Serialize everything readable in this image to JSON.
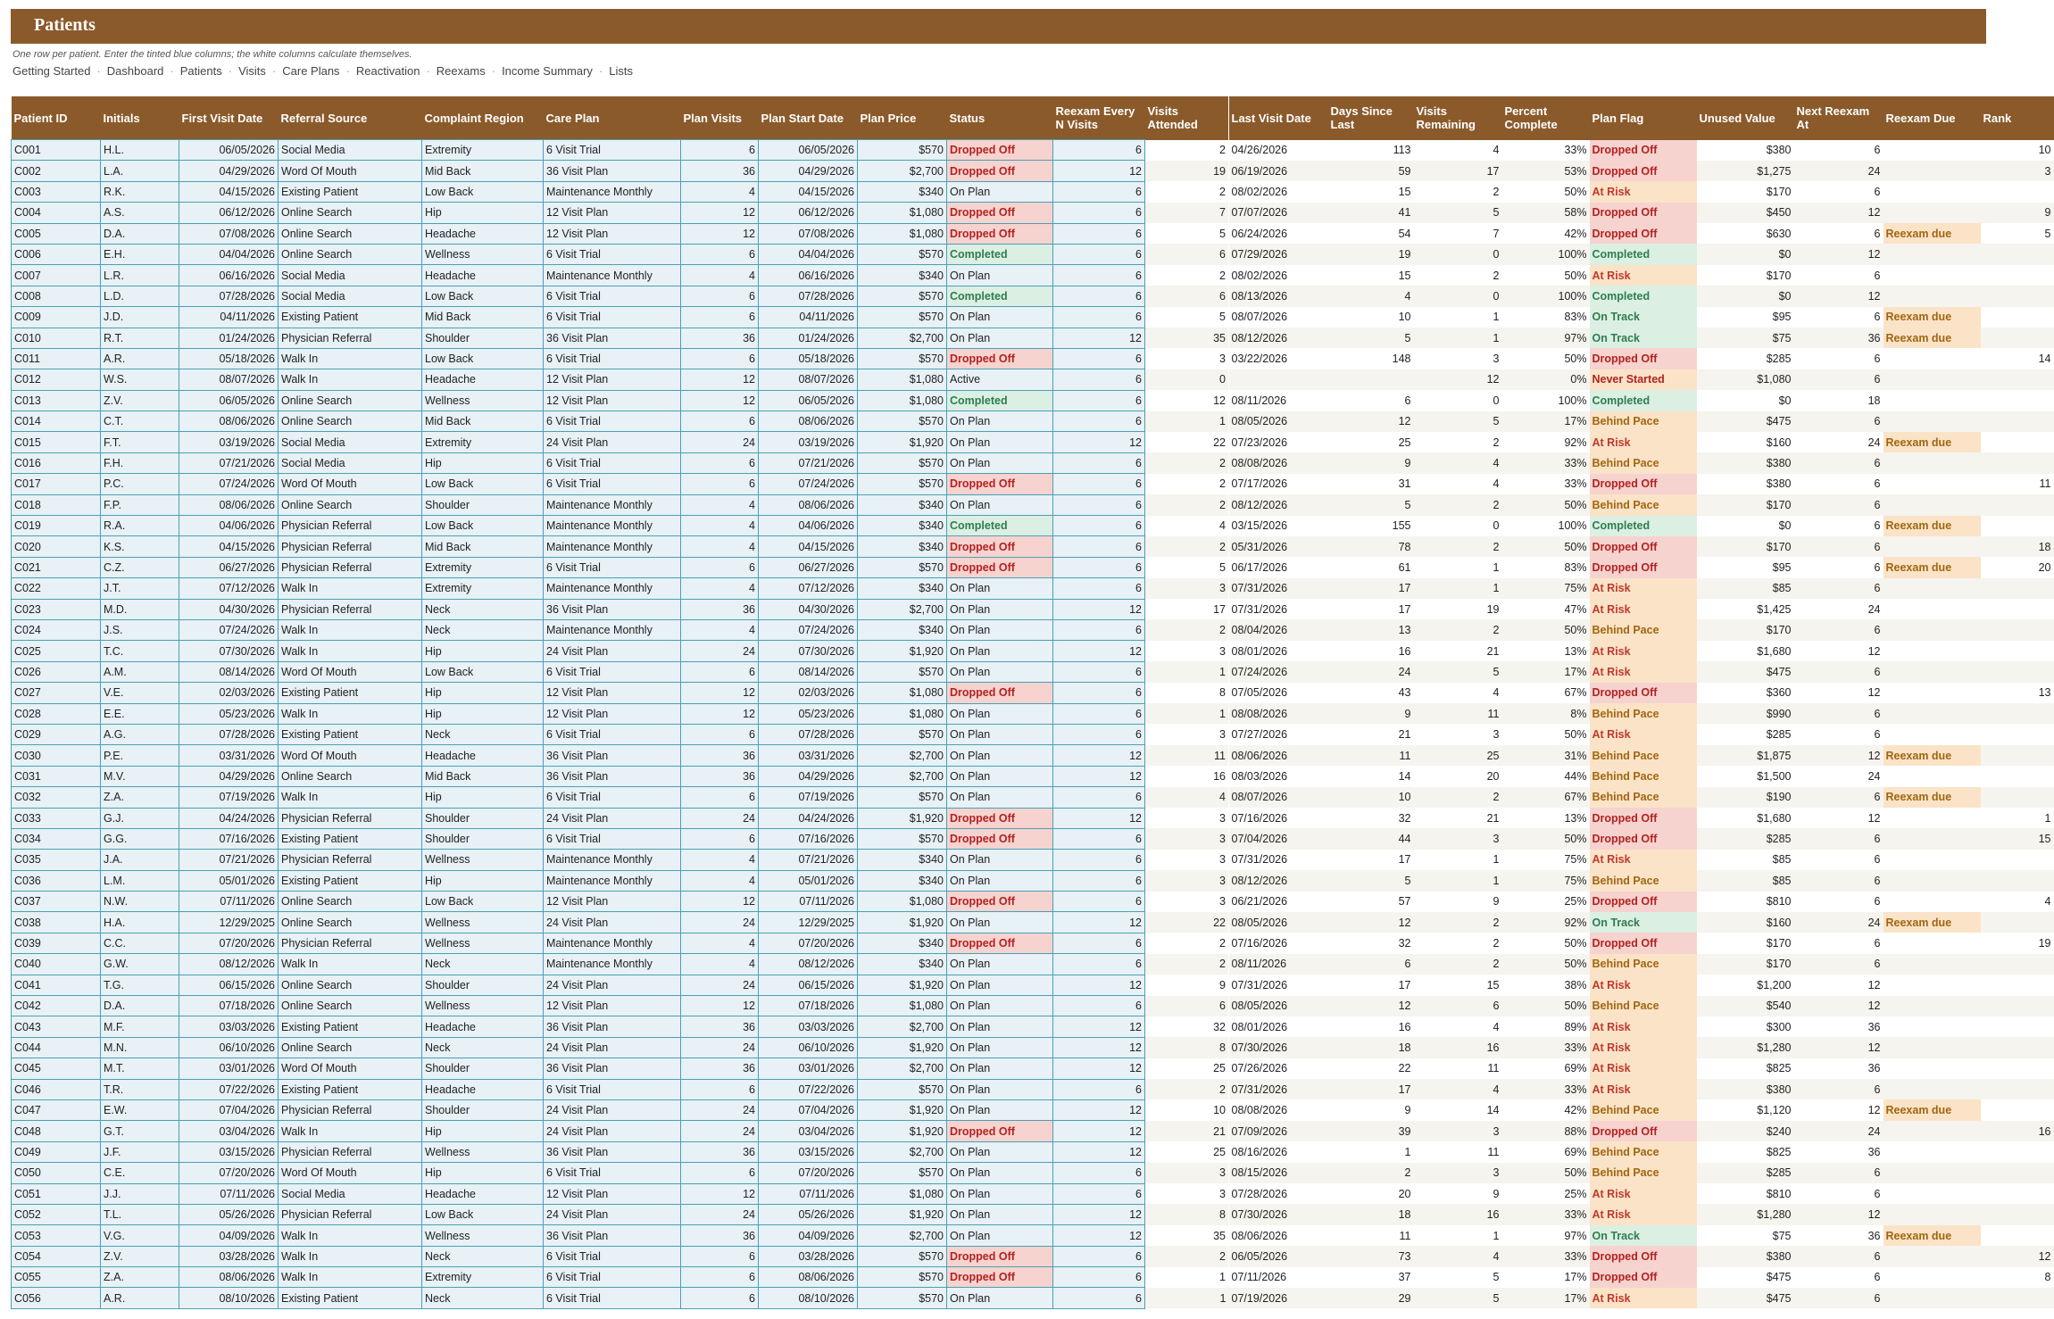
{
  "header": {
    "title": "Patients",
    "subtitle": "One row per patient. Enter the tinted blue columns; the white columns calculate themselves."
  },
  "nav": [
    "Getting Started",
    "Dashboard",
    "Patients",
    "Visits",
    "Care Plans",
    "Reactivation",
    "Reexams",
    "Income Summary",
    "Lists"
  ],
  "columns": [
    "Patient ID",
    "Initials",
    "First Visit Date",
    "Referral Source",
    "Complaint Region",
    "Care Plan",
    "Plan Visits",
    "Plan Start Date",
    "Plan Price",
    "Status",
    "Reexam Every N Visits",
    "Visits Attended",
    "Last Visit Date",
    "Days Since Last",
    "Visits Remaining",
    "Percent Complete",
    "Plan Flag",
    "Unused Value",
    "Next Reexam At",
    "Reexam Due",
    "Rank"
  ],
  "rows": [
    [
      "C001",
      "H.L.",
      "06/05/2026",
      "Social Media",
      "Extremity",
      "6 Visit Trial",
      "6",
      "06/05/2026",
      "$570",
      "Dropped Off",
      "6",
      "2",
      "04/26/2026",
      "113",
      "4",
      "33%",
      "Dropped Off",
      "$380",
      "6",
      "",
      "10"
    ],
    [
      "C002",
      "L.A.",
      "04/29/2026",
      "Word Of Mouth",
      "Mid Back",
      "36 Visit Plan",
      "36",
      "04/29/2026",
      "$2,700",
      "Dropped Off",
      "12",
      "19",
      "06/19/2026",
      "59",
      "17",
      "53%",
      "Dropped Off",
      "$1,275",
      "24",
      "",
      "3"
    ],
    [
      "C003",
      "R.K.",
      "04/15/2026",
      "Existing Patient",
      "Low Back",
      "Maintenance Monthly",
      "4",
      "04/15/2026",
      "$340",
      "On Plan",
      "6",
      "2",
      "08/02/2026",
      "15",
      "2",
      "50%",
      "At Risk",
      "$170",
      "6",
      "",
      ""
    ],
    [
      "C004",
      "A.S.",
      "06/12/2026",
      "Online Search",
      "Hip",
      "12 Visit Plan",
      "12",
      "06/12/2026",
      "$1,080",
      "Dropped Off",
      "6",
      "7",
      "07/07/2026",
      "41",
      "5",
      "58%",
      "Dropped Off",
      "$450",
      "12",
      "",
      "9"
    ],
    [
      "C005",
      "D.A.",
      "07/08/2026",
      "Online Search",
      "Headache",
      "12 Visit Plan",
      "12",
      "07/08/2026",
      "$1,080",
      "Dropped Off",
      "6",
      "5",
      "06/24/2026",
      "54",
      "7",
      "42%",
      "Dropped Off",
      "$630",
      "6",
      "Reexam due",
      "5"
    ],
    [
      "C006",
      "E.H.",
      "04/04/2026",
      "Online Search",
      "Wellness",
      "6 Visit Trial",
      "6",
      "04/04/2026",
      "$570",
      "Completed",
      "6",
      "6",
      "07/29/2026",
      "19",
      "0",
      "100%",
      "Completed",
      "$0",
      "12",
      "",
      ""
    ],
    [
      "C007",
      "L.R.",
      "06/16/2026",
      "Social Media",
      "Headache",
      "Maintenance Monthly",
      "4",
      "06/16/2026",
      "$340",
      "On Plan",
      "6",
      "2",
      "08/02/2026",
      "15",
      "2",
      "50%",
      "At Risk",
      "$170",
      "6",
      "",
      ""
    ],
    [
      "C008",
      "L.D.",
      "07/28/2026",
      "Social Media",
      "Low Back",
      "6 Visit Trial",
      "6",
      "07/28/2026",
      "$570",
      "Completed",
      "6",
      "6",
      "08/13/2026",
      "4",
      "0",
      "100%",
      "Completed",
      "$0",
      "12",
      "",
      ""
    ],
    [
      "C009",
      "J.D.",
      "04/11/2026",
      "Existing Patient",
      "Mid Back",
      "6 Visit Trial",
      "6",
      "04/11/2026",
      "$570",
      "On Plan",
      "6",
      "5",
      "08/07/2026",
      "10",
      "1",
      "83%",
      "On Track",
      "$95",
      "6",
      "Reexam due",
      ""
    ],
    [
      "C010",
      "R.T.",
      "01/24/2026",
      "Physician Referral",
      "Shoulder",
      "36 Visit Plan",
      "36",
      "01/24/2026",
      "$2,700",
      "On Plan",
      "12",
      "35",
      "08/12/2026",
      "5",
      "1",
      "97%",
      "On Track",
      "$75",
      "36",
      "Reexam due",
      ""
    ],
    [
      "C011",
      "A.R.",
      "05/18/2026",
      "Walk In",
      "Low Back",
      "6 Visit Trial",
      "6",
      "05/18/2026",
      "$570",
      "Dropped Off",
      "6",
      "3",
      "03/22/2026",
      "148",
      "3",
      "50%",
      "Dropped Off",
      "$285",
      "6",
      "",
      "14"
    ],
    [
      "C012",
      "W.S.",
      "08/07/2026",
      "Walk In",
      "Headache",
      "12 Visit Plan",
      "12",
      "08/07/2026",
      "$1,080",
      "Active",
      "6",
      "0",
      "",
      "",
      "12",
      "0%",
      "Never Started",
      "$1,080",
      "6",
      "",
      ""
    ],
    [
      "C013",
      "Z.V.",
      "06/05/2026",
      "Online Search",
      "Wellness",
      "12 Visit Plan",
      "12",
      "06/05/2026",
      "$1,080",
      "Completed",
      "6",
      "12",
      "08/11/2026",
      "6",
      "0",
      "100%",
      "Completed",
      "$0",
      "18",
      "",
      ""
    ],
    [
      "C014",
      "C.T.",
      "08/06/2026",
      "Online Search",
      "Mid Back",
      "6 Visit Trial",
      "6",
      "08/06/2026",
      "$570",
      "On Plan",
      "6",
      "1",
      "08/05/2026",
      "12",
      "5",
      "17%",
      "Behind Pace",
      "$475",
      "6",
      "",
      ""
    ],
    [
      "C015",
      "F.T.",
      "03/19/2026",
      "Social Media",
      "Extremity",
      "24 Visit Plan",
      "24",
      "03/19/2026",
      "$1,920",
      "On Plan",
      "12",
      "22",
      "07/23/2026",
      "25",
      "2",
      "92%",
      "At Risk",
      "$160",
      "24",
      "Reexam due",
      ""
    ],
    [
      "C016",
      "F.H.",
      "07/21/2026",
      "Social Media",
      "Hip",
      "6 Visit Trial",
      "6",
      "07/21/2026",
      "$570",
      "On Plan",
      "6",
      "2",
      "08/08/2026",
      "9",
      "4",
      "33%",
      "Behind Pace",
      "$380",
      "6",
      "",
      ""
    ],
    [
      "C017",
      "P.C.",
      "07/24/2026",
      "Word Of Mouth",
      "Low Back",
      "6 Visit Trial",
      "6",
      "07/24/2026",
      "$570",
      "Dropped Off",
      "6",
      "2",
      "07/17/2026",
      "31",
      "4",
      "33%",
      "Dropped Off",
      "$380",
      "6",
      "",
      "11"
    ],
    [
      "C018",
      "F.P.",
      "08/06/2026",
      "Online Search",
      "Shoulder",
      "Maintenance Monthly",
      "4",
      "08/06/2026",
      "$340",
      "On Plan",
      "6",
      "2",
      "08/12/2026",
      "5",
      "2",
      "50%",
      "Behind Pace",
      "$170",
      "6",
      "",
      ""
    ],
    [
      "C019",
      "R.A.",
      "04/06/2026",
      "Physician Referral",
      "Low Back",
      "Maintenance Monthly",
      "4",
      "04/06/2026",
      "$340",
      "Completed",
      "6",
      "4",
      "03/15/2026",
      "155",
      "0",
      "100%",
      "Completed",
      "$0",
      "6",
      "Reexam due",
      ""
    ],
    [
      "C020",
      "K.S.",
      "04/15/2026",
      "Physician Referral",
      "Mid Back",
      "Maintenance Monthly",
      "4",
      "04/15/2026",
      "$340",
      "Dropped Off",
      "6",
      "2",
      "05/31/2026",
      "78",
      "2",
      "50%",
      "Dropped Off",
      "$170",
      "6",
      "",
      "18"
    ],
    [
      "C021",
      "C.Z.",
      "06/27/2026",
      "Physician Referral",
      "Extremity",
      "6 Visit Trial",
      "6",
      "06/27/2026",
      "$570",
      "Dropped Off",
      "6",
      "5",
      "06/17/2026",
      "61",
      "1",
      "83%",
      "Dropped Off",
      "$95",
      "6",
      "Reexam due",
      "20"
    ],
    [
      "C022",
      "J.T.",
      "07/12/2026",
      "Walk In",
      "Extremity",
      "Maintenance Monthly",
      "4",
      "07/12/2026",
      "$340",
      "On Plan",
      "6",
      "3",
      "07/31/2026",
      "17",
      "1",
      "75%",
      "At Risk",
      "$85",
      "6",
      "",
      ""
    ],
    [
      "C023",
      "M.D.",
      "04/30/2026",
      "Physician Referral",
      "Neck",
      "36 Visit Plan",
      "36",
      "04/30/2026",
      "$2,700",
      "On Plan",
      "12",
      "17",
      "07/31/2026",
      "17",
      "19",
      "47%",
      "At Risk",
      "$1,425",
      "24",
      "",
      ""
    ],
    [
      "C024",
      "J.S.",
      "07/24/2026",
      "Walk In",
      "Neck",
      "Maintenance Monthly",
      "4",
      "07/24/2026",
      "$340",
      "On Plan",
      "6",
      "2",
      "08/04/2026",
      "13",
      "2",
      "50%",
      "Behind Pace",
      "$170",
      "6",
      "",
      ""
    ],
    [
      "C025",
      "T.C.",
      "07/30/2026",
      "Walk In",
      "Hip",
      "24 Visit Plan",
      "24",
      "07/30/2026",
      "$1,920",
      "On Plan",
      "12",
      "3",
      "08/01/2026",
      "16",
      "21",
      "13%",
      "At Risk",
      "$1,680",
      "12",
      "",
      ""
    ],
    [
      "C026",
      "A.M.",
      "08/14/2026",
      "Word Of Mouth",
      "Low Back",
      "6 Visit Trial",
      "6",
      "08/14/2026",
      "$570",
      "On Plan",
      "6",
      "1",
      "07/24/2026",
      "24",
      "5",
      "17%",
      "At Risk",
      "$475",
      "6",
      "",
      ""
    ],
    [
      "C027",
      "V.E.",
      "02/03/2026",
      "Existing Patient",
      "Hip",
      "12 Visit Plan",
      "12",
      "02/03/2026",
      "$1,080",
      "Dropped Off",
      "6",
      "8",
      "07/05/2026",
      "43",
      "4",
      "67%",
      "Dropped Off",
      "$360",
      "12",
      "",
      "13"
    ],
    [
      "C028",
      "E.E.",
      "05/23/2026",
      "Walk In",
      "Hip",
      "12 Visit Plan",
      "12",
      "05/23/2026",
      "$1,080",
      "On Plan",
      "6",
      "1",
      "08/08/2026",
      "9",
      "11",
      "8%",
      "Behind Pace",
      "$990",
      "6",
      "",
      ""
    ],
    [
      "C029",
      "A.G.",
      "07/28/2026",
      "Existing Patient",
      "Neck",
      "6 Visit Trial",
      "6",
      "07/28/2026",
      "$570",
      "On Plan",
      "6",
      "3",
      "07/27/2026",
      "21",
      "3",
      "50%",
      "At Risk",
      "$285",
      "6",
      "",
      ""
    ],
    [
      "C030",
      "P.E.",
      "03/31/2026",
      "Word Of Mouth",
      "Headache",
      "36 Visit Plan",
      "36",
      "03/31/2026",
      "$2,700",
      "On Plan",
      "12",
      "11",
      "08/06/2026",
      "11",
      "25",
      "31%",
      "Behind Pace",
      "$1,875",
      "12",
      "Reexam due",
      ""
    ],
    [
      "C031",
      "M.V.",
      "04/29/2026",
      "Online Search",
      "Mid Back",
      "36 Visit Plan",
      "36",
      "04/29/2026",
      "$2,700",
      "On Plan",
      "12",
      "16",
      "08/03/2026",
      "14",
      "20",
      "44%",
      "Behind Pace",
      "$1,500",
      "24",
      "",
      ""
    ],
    [
      "C032",
      "Z.A.",
      "07/19/2026",
      "Walk In",
      "Hip",
      "6 Visit Trial",
      "6",
      "07/19/2026",
      "$570",
      "On Plan",
      "6",
      "4",
      "08/07/2026",
      "10",
      "2",
      "67%",
      "Behind Pace",
      "$190",
      "6",
      "Reexam due",
      ""
    ],
    [
      "C033",
      "G.J.",
      "04/24/2026",
      "Physician Referral",
      "Shoulder",
      "24 Visit Plan",
      "24",
      "04/24/2026",
      "$1,920",
      "Dropped Off",
      "12",
      "3",
      "07/16/2026",
      "32",
      "21",
      "13%",
      "Dropped Off",
      "$1,680",
      "12",
      "",
      "1"
    ],
    [
      "C034",
      "G.G.",
      "07/16/2026",
      "Existing Patient",
      "Shoulder",
      "6 Visit Trial",
      "6",
      "07/16/2026",
      "$570",
      "Dropped Off",
      "6",
      "3",
      "07/04/2026",
      "44",
      "3",
      "50%",
      "Dropped Off",
      "$285",
      "6",
      "",
      "15"
    ],
    [
      "C035",
      "J.A.",
      "07/21/2026",
      "Physician Referral",
      "Wellness",
      "Maintenance Monthly",
      "4",
      "07/21/2026",
      "$340",
      "On Plan",
      "6",
      "3",
      "07/31/2026",
      "17",
      "1",
      "75%",
      "At Risk",
      "$85",
      "6",
      "",
      ""
    ],
    [
      "C036",
      "L.M.",
      "05/01/2026",
      "Existing Patient",
      "Hip",
      "Maintenance Monthly",
      "4",
      "05/01/2026",
      "$340",
      "On Plan",
      "6",
      "3",
      "08/12/2026",
      "5",
      "1",
      "75%",
      "Behind Pace",
      "$85",
      "6",
      "",
      ""
    ],
    [
      "C037",
      "N.W.",
      "07/11/2026",
      "Online Search",
      "Low Back",
      "12 Visit Plan",
      "12",
      "07/11/2026",
      "$1,080",
      "Dropped Off",
      "6",
      "3",
      "06/21/2026",
      "57",
      "9",
      "25%",
      "Dropped Off",
      "$810",
      "6",
      "",
      "4"
    ],
    [
      "C038",
      "H.A.",
      "12/29/2025",
      "Online Search",
      "Wellness",
      "24 Visit Plan",
      "24",
      "12/29/2025",
      "$1,920",
      "On Plan",
      "12",
      "22",
      "08/05/2026",
      "12",
      "2",
      "92%",
      "On Track",
      "$160",
      "24",
      "Reexam due",
      ""
    ],
    [
      "C039",
      "C.C.",
      "07/20/2026",
      "Physician Referral",
      "Wellness",
      "Maintenance Monthly",
      "4",
      "07/20/2026",
      "$340",
      "Dropped Off",
      "6",
      "2",
      "07/16/2026",
      "32",
      "2",
      "50%",
      "Dropped Off",
      "$170",
      "6",
      "",
      "19"
    ],
    [
      "C040",
      "G.W.",
      "08/12/2026",
      "Walk In",
      "Neck",
      "Maintenance Monthly",
      "4",
      "08/12/2026",
      "$340",
      "On Plan",
      "6",
      "2",
      "08/11/2026",
      "6",
      "2",
      "50%",
      "Behind Pace",
      "$170",
      "6",
      "",
      ""
    ],
    [
      "C041",
      "T.G.",
      "06/15/2026",
      "Online Search",
      "Shoulder",
      "24 Visit Plan",
      "24",
      "06/15/2026",
      "$1,920",
      "On Plan",
      "12",
      "9",
      "07/31/2026",
      "17",
      "15",
      "38%",
      "At Risk",
      "$1,200",
      "12",
      "",
      ""
    ],
    [
      "C042",
      "D.A.",
      "07/18/2026",
      "Online Search",
      "Wellness",
      "12 Visit Plan",
      "12",
      "07/18/2026",
      "$1,080",
      "On Plan",
      "6",
      "6",
      "08/05/2026",
      "12",
      "6",
      "50%",
      "Behind Pace",
      "$540",
      "12",
      "",
      ""
    ],
    [
      "C043",
      "M.F.",
      "03/03/2026",
      "Existing Patient",
      "Headache",
      "36 Visit Plan",
      "36",
      "03/03/2026",
      "$2,700",
      "On Plan",
      "12",
      "32",
      "08/01/2026",
      "16",
      "4",
      "89%",
      "At Risk",
      "$300",
      "36",
      "",
      ""
    ],
    [
      "C044",
      "M.N.",
      "06/10/2026",
      "Online Search",
      "Neck",
      "24 Visit Plan",
      "24",
      "06/10/2026",
      "$1,920",
      "On Plan",
      "12",
      "8",
      "07/30/2026",
      "18",
      "16",
      "33%",
      "At Risk",
      "$1,280",
      "12",
      "",
      ""
    ],
    [
      "C045",
      "M.T.",
      "03/01/2026",
      "Word Of Mouth",
      "Shoulder",
      "36 Visit Plan",
      "36",
      "03/01/2026",
      "$2,700",
      "On Plan",
      "12",
      "25",
      "07/26/2026",
      "22",
      "11",
      "69%",
      "At Risk",
      "$825",
      "36",
      "",
      ""
    ],
    [
      "C046",
      "T.R.",
      "07/22/2026",
      "Existing Patient",
      "Headache",
      "6 Visit Trial",
      "6",
      "07/22/2026",
      "$570",
      "On Plan",
      "6",
      "2",
      "07/31/2026",
      "17",
      "4",
      "33%",
      "At Risk",
      "$380",
      "6",
      "",
      ""
    ],
    [
      "C047",
      "E.W.",
      "07/04/2026",
      "Physician Referral",
      "Shoulder",
      "24 Visit Plan",
      "24",
      "07/04/2026",
      "$1,920",
      "On Plan",
      "12",
      "10",
      "08/08/2026",
      "9",
      "14",
      "42%",
      "Behind Pace",
      "$1,120",
      "12",
      "Reexam due",
      ""
    ],
    [
      "C048",
      "G.T.",
      "03/04/2026",
      "Walk In",
      "Hip",
      "24 Visit Plan",
      "24",
      "03/04/2026",
      "$1,920",
      "Dropped Off",
      "12",
      "21",
      "07/09/2026",
      "39",
      "3",
      "88%",
      "Dropped Off",
      "$240",
      "24",
      "",
      "16"
    ],
    [
      "C049",
      "J.F.",
      "03/15/2026",
      "Physician Referral",
      "Wellness",
      "36 Visit Plan",
      "36",
      "03/15/2026",
      "$2,700",
      "On Plan",
      "12",
      "25",
      "08/16/2026",
      "1",
      "11",
      "69%",
      "Behind Pace",
      "$825",
      "36",
      "",
      ""
    ],
    [
      "C050",
      "C.E.",
      "07/20/2026",
      "Word Of Mouth",
      "Hip",
      "6 Visit Trial",
      "6",
      "07/20/2026",
      "$570",
      "On Plan",
      "6",
      "3",
      "08/15/2026",
      "2",
      "3",
      "50%",
      "Behind Pace",
      "$285",
      "6",
      "",
      ""
    ],
    [
      "C051",
      "J.J.",
      "07/11/2026",
      "Social Media",
      "Headache",
      "12 Visit Plan",
      "12",
      "07/11/2026",
      "$1,080",
      "On Plan",
      "6",
      "3",
      "07/28/2026",
      "20",
      "9",
      "25%",
      "At Risk",
      "$810",
      "6",
      "",
      ""
    ],
    [
      "C052",
      "T.L.",
      "05/26/2026",
      "Physician Referral",
      "Low Back",
      "24 Visit Plan",
      "24",
      "05/26/2026",
      "$1,920",
      "On Plan",
      "12",
      "8",
      "07/30/2026",
      "18",
      "16",
      "33%",
      "At Risk",
      "$1,280",
      "12",
      "",
      ""
    ],
    [
      "C053",
      "V.G.",
      "04/09/2026",
      "Walk In",
      "Wellness",
      "36 Visit Plan",
      "36",
      "04/09/2026",
      "$2,700",
      "On Plan",
      "12",
      "35",
      "08/06/2026",
      "11",
      "1",
      "97%",
      "On Track",
      "$75",
      "36",
      "Reexam due",
      ""
    ],
    [
      "C054",
      "Z.V.",
      "03/28/2026",
      "Walk In",
      "Neck",
      "6 Visit Trial",
      "6",
      "03/28/2026",
      "$570",
      "Dropped Off",
      "6",
      "2",
      "06/05/2026",
      "73",
      "4",
      "33%",
      "Dropped Off",
      "$380",
      "6",
      "",
      "12"
    ],
    [
      "C055",
      "Z.A.",
      "08/06/2026",
      "Walk In",
      "Extremity",
      "6 Visit Trial",
      "6",
      "08/06/2026",
      "$570",
      "Dropped Off",
      "6",
      "1",
      "07/11/2026",
      "37",
      "5",
      "17%",
      "Dropped Off",
      "$475",
      "6",
      "",
      "8"
    ],
    [
      "C056",
      "A.R.",
      "08/10/2026",
      "Existing Patient",
      "Neck",
      "6 Visit Trial",
      "6",
      "08/10/2026",
      "$570",
      "On Plan",
      "6",
      "1",
      "07/19/2026",
      "29",
      "5",
      "17%",
      "At Risk",
      "$475",
      "6",
      "",
      ""
    ]
  ]
}
